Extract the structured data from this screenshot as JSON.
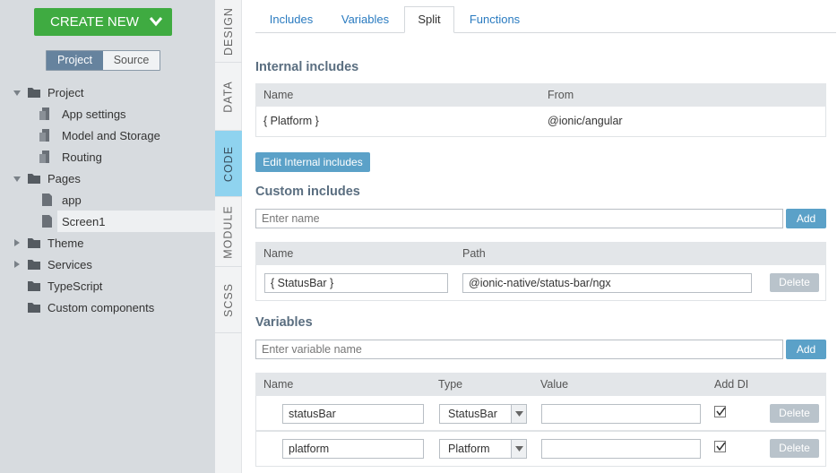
{
  "sidebar": {
    "create_button": "CREATE NEW",
    "segment": {
      "project": "Project",
      "source": "Source"
    },
    "tree": [
      {
        "label": "Project"
      },
      {
        "label": "App settings"
      },
      {
        "label": "Model and Storage"
      },
      {
        "label": "Routing"
      },
      {
        "label": "Pages"
      },
      {
        "label": "app"
      },
      {
        "label": "Screen1"
      },
      {
        "label": "Theme"
      },
      {
        "label": "Services"
      },
      {
        "label": "TypeScript"
      },
      {
        "label": "Custom components"
      }
    ]
  },
  "vertical_tabs": [
    "DESIGN",
    "DATA",
    "CODE",
    "MODULE",
    "SCSS"
  ],
  "tabs": [
    "Includes",
    "Variables",
    "Split",
    "Functions"
  ],
  "internal_includes": {
    "title": "Internal includes",
    "headers": {
      "name": "Name",
      "from": "From"
    },
    "rows": [
      {
        "name": "{ Platform }",
        "from": "@ionic/angular"
      }
    ],
    "edit_button": "Edit Internal includes"
  },
  "custom_includes": {
    "title": "Custom includes",
    "name_placeholder": "Enter name",
    "add_button": "Add",
    "headers": {
      "name": "Name",
      "path": "Path"
    },
    "rows": [
      {
        "name": "{ StatusBar }",
        "path": "@ionic-native/status-bar/ngx",
        "delete": "Delete"
      }
    ]
  },
  "variables": {
    "title": "Variables",
    "name_placeholder": "Enter variable name",
    "add_button": "Add",
    "headers": {
      "name": "Name",
      "type": "Type",
      "value": "Value",
      "add_di": "Add DI"
    },
    "rows": [
      {
        "name": "statusBar",
        "type": "StatusBar",
        "value": "",
        "delete": "Delete"
      },
      {
        "name": "platform",
        "type": "Platform",
        "value": "",
        "delete": "Delete"
      }
    ]
  },
  "colors": {
    "create_green": "#3fab41",
    "accent_blue": "#5ba1c8",
    "active_vtab": "#8fd3ef",
    "sidebar_bg": "#d7dbdf"
  }
}
